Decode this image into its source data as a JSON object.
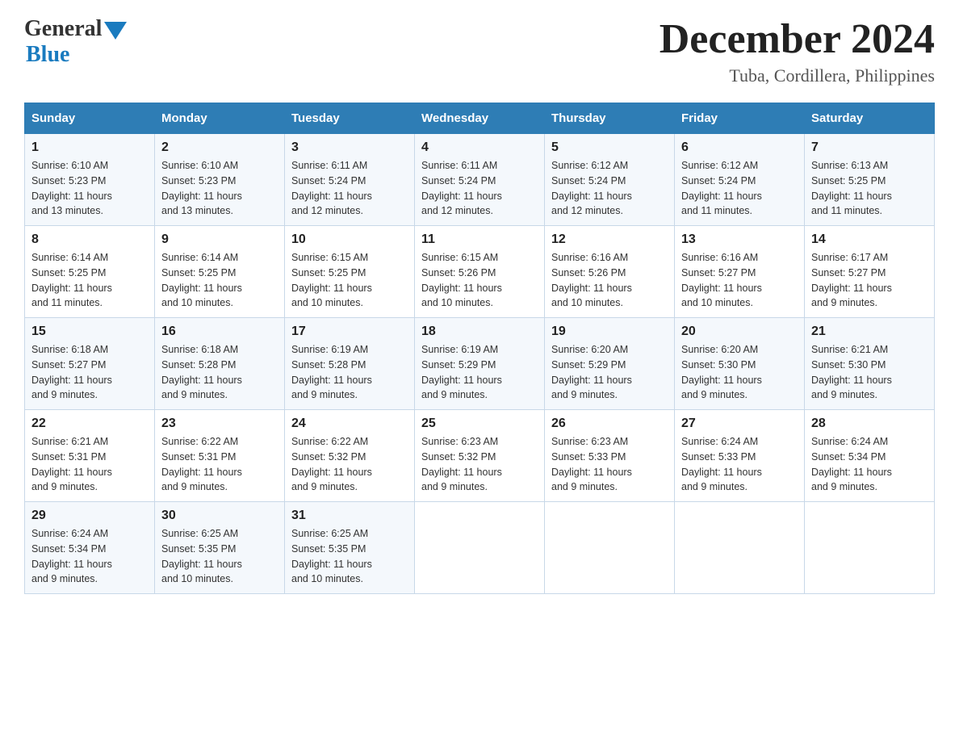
{
  "logo": {
    "general": "General",
    "blue": "Blue",
    "triangle_color": "#1a7bbf"
  },
  "title": {
    "month_year": "December 2024",
    "location": "Tuba, Cordillera, Philippines"
  },
  "weekdays": [
    "Sunday",
    "Monday",
    "Tuesday",
    "Wednesday",
    "Thursday",
    "Friday",
    "Saturday"
  ],
  "weeks": [
    [
      {
        "day": "1",
        "sunrise": "6:10 AM",
        "sunset": "5:23 PM",
        "daylight": "11 hours and 13 minutes."
      },
      {
        "day": "2",
        "sunrise": "6:10 AM",
        "sunset": "5:23 PM",
        "daylight": "11 hours and 13 minutes."
      },
      {
        "day": "3",
        "sunrise": "6:11 AM",
        "sunset": "5:24 PM",
        "daylight": "11 hours and 12 minutes."
      },
      {
        "day": "4",
        "sunrise": "6:11 AM",
        "sunset": "5:24 PM",
        "daylight": "11 hours and 12 minutes."
      },
      {
        "day": "5",
        "sunrise": "6:12 AM",
        "sunset": "5:24 PM",
        "daylight": "11 hours and 12 minutes."
      },
      {
        "day": "6",
        "sunrise": "6:12 AM",
        "sunset": "5:24 PM",
        "daylight": "11 hours and 11 minutes."
      },
      {
        "day": "7",
        "sunrise": "6:13 AM",
        "sunset": "5:25 PM",
        "daylight": "11 hours and 11 minutes."
      }
    ],
    [
      {
        "day": "8",
        "sunrise": "6:14 AM",
        "sunset": "5:25 PM",
        "daylight": "11 hours and 11 minutes."
      },
      {
        "day": "9",
        "sunrise": "6:14 AM",
        "sunset": "5:25 PM",
        "daylight": "11 hours and 10 minutes."
      },
      {
        "day": "10",
        "sunrise": "6:15 AM",
        "sunset": "5:25 PM",
        "daylight": "11 hours and 10 minutes."
      },
      {
        "day": "11",
        "sunrise": "6:15 AM",
        "sunset": "5:26 PM",
        "daylight": "11 hours and 10 minutes."
      },
      {
        "day": "12",
        "sunrise": "6:16 AM",
        "sunset": "5:26 PM",
        "daylight": "11 hours and 10 minutes."
      },
      {
        "day": "13",
        "sunrise": "6:16 AM",
        "sunset": "5:27 PM",
        "daylight": "11 hours and 10 minutes."
      },
      {
        "day": "14",
        "sunrise": "6:17 AM",
        "sunset": "5:27 PM",
        "daylight": "11 hours and 9 minutes."
      }
    ],
    [
      {
        "day": "15",
        "sunrise": "6:18 AM",
        "sunset": "5:27 PM",
        "daylight": "11 hours and 9 minutes."
      },
      {
        "day": "16",
        "sunrise": "6:18 AM",
        "sunset": "5:28 PM",
        "daylight": "11 hours and 9 minutes."
      },
      {
        "day": "17",
        "sunrise": "6:19 AM",
        "sunset": "5:28 PM",
        "daylight": "11 hours and 9 minutes."
      },
      {
        "day": "18",
        "sunrise": "6:19 AM",
        "sunset": "5:29 PM",
        "daylight": "11 hours and 9 minutes."
      },
      {
        "day": "19",
        "sunrise": "6:20 AM",
        "sunset": "5:29 PM",
        "daylight": "11 hours and 9 minutes."
      },
      {
        "day": "20",
        "sunrise": "6:20 AM",
        "sunset": "5:30 PM",
        "daylight": "11 hours and 9 minutes."
      },
      {
        "day": "21",
        "sunrise": "6:21 AM",
        "sunset": "5:30 PM",
        "daylight": "11 hours and 9 minutes."
      }
    ],
    [
      {
        "day": "22",
        "sunrise": "6:21 AM",
        "sunset": "5:31 PM",
        "daylight": "11 hours and 9 minutes."
      },
      {
        "day": "23",
        "sunrise": "6:22 AM",
        "sunset": "5:31 PM",
        "daylight": "11 hours and 9 minutes."
      },
      {
        "day": "24",
        "sunrise": "6:22 AM",
        "sunset": "5:32 PM",
        "daylight": "11 hours and 9 minutes."
      },
      {
        "day": "25",
        "sunrise": "6:23 AM",
        "sunset": "5:32 PM",
        "daylight": "11 hours and 9 minutes."
      },
      {
        "day": "26",
        "sunrise": "6:23 AM",
        "sunset": "5:33 PM",
        "daylight": "11 hours and 9 minutes."
      },
      {
        "day": "27",
        "sunrise": "6:24 AM",
        "sunset": "5:33 PM",
        "daylight": "11 hours and 9 minutes."
      },
      {
        "day": "28",
        "sunrise": "6:24 AM",
        "sunset": "5:34 PM",
        "daylight": "11 hours and 9 minutes."
      }
    ],
    [
      {
        "day": "29",
        "sunrise": "6:24 AM",
        "sunset": "5:34 PM",
        "daylight": "11 hours and 9 minutes."
      },
      {
        "day": "30",
        "sunrise": "6:25 AM",
        "sunset": "5:35 PM",
        "daylight": "11 hours and 10 minutes."
      },
      {
        "day": "31",
        "sunrise": "6:25 AM",
        "sunset": "5:35 PM",
        "daylight": "11 hours and 10 minutes."
      },
      null,
      null,
      null,
      null
    ]
  ],
  "labels": {
    "sunrise": "Sunrise:",
    "sunset": "Sunset:",
    "daylight": "Daylight:"
  }
}
